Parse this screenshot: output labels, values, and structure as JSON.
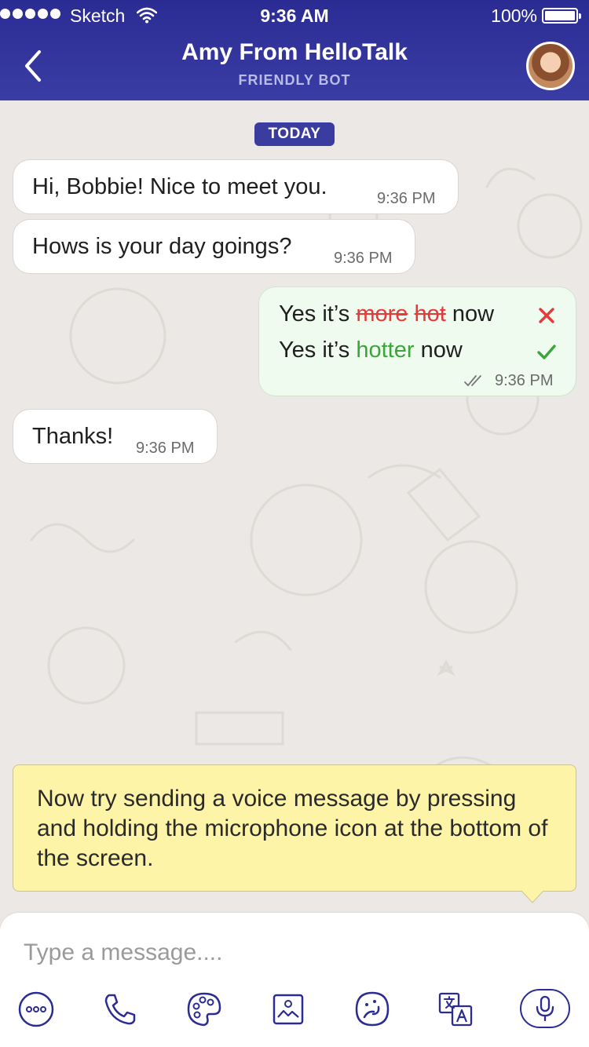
{
  "status_bar": {
    "carrier": "Sketch",
    "time": "9:36 AM",
    "battery": "100%",
    "signal_bars": 5,
    "battery_level": 1.0
  },
  "header": {
    "title": "Amy From HelloTalk",
    "subtitle": "FRIENDLY BOT",
    "back_icon": "chevron-left-icon",
    "avatar_icon": "avatar"
  },
  "chat": {
    "date_label": "TODAY",
    "messages": [
      {
        "from": "bot",
        "text": "Hi, Bobbie! Nice to meet you.",
        "time": "9:36 PM"
      },
      {
        "from": "bot",
        "text": "Hows is your day goings?",
        "time": "9:36 PM"
      },
      {
        "from": "me",
        "correction": {
          "original_prefix": "Yes it’s ",
          "original_wrong_1": "more",
          "original_wrong_2": "hot",
          "original_suffix": " now",
          "corrected_prefix": "Yes it’s ",
          "corrected_word": "hotter",
          "corrected_suffix": " now"
        },
        "time": "9:36 PM",
        "status_icon": "double-check-icon"
      },
      {
        "from": "bot",
        "text": "Thanks!",
        "time": "9:36 PM"
      }
    ]
  },
  "hint": {
    "text": "Now try sending a voice message by pressing and holding the microphone icon at the bottom of the screen."
  },
  "composer": {
    "placeholder": "Type a message....",
    "tools": [
      "more-icon",
      "phone-icon",
      "palette-icon",
      "image-icon",
      "sticker-icon",
      "translate-icon",
      "microphone-icon"
    ]
  },
  "colors": {
    "header": "#2b2c93",
    "accent": "#2b2c93",
    "correct": "#3aa53a",
    "wrong": "#e53a3a",
    "hint_bg": "#fdf4a8",
    "chat_bg": "#ebe8e5",
    "my_bubble": "#effbef"
  }
}
